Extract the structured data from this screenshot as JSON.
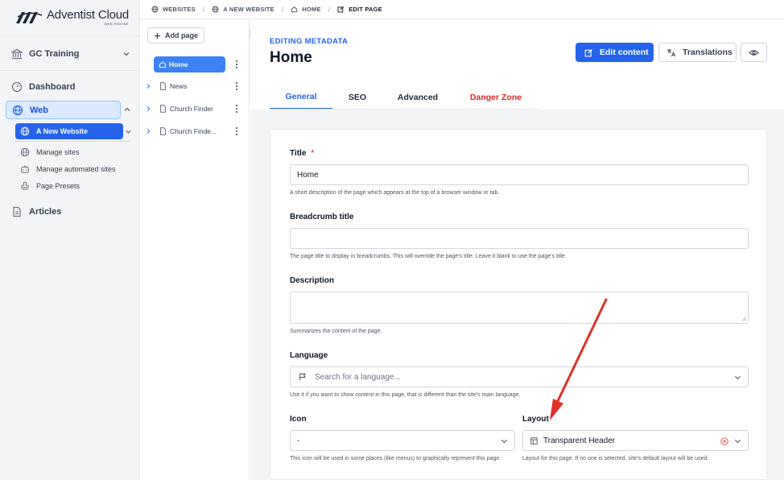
{
  "brand": {
    "name": "Adventist Cloud",
    "sub": "WEB ENGINE"
  },
  "sidebar": {
    "org": "GC Training",
    "dashboard": "Dashboard",
    "web": "Web",
    "site": "A New Website",
    "sub_items": [
      "Manage sites",
      "Manage automated sites",
      "Page Presets"
    ],
    "articles": "Articles"
  },
  "breadcrumb": {
    "websites": "WEBSITES",
    "new_website": "A NEW WEBSITE",
    "home": "HOME",
    "edit_page": "EDIT PAGE"
  },
  "tree": {
    "add_page": "Add page",
    "items": [
      "Home",
      "News",
      "Church Finder",
      "Church Finde..."
    ]
  },
  "header": {
    "kicker": "EDITING METADATA",
    "title": "Home",
    "edit_content": "Edit content",
    "translations": "Translations"
  },
  "tabs": [
    "General",
    "SEO",
    "Advanced",
    "Danger Zone"
  ],
  "form": {
    "title": {
      "label": "Title",
      "required": "*",
      "value": "Home",
      "help": "A short description of the page which appears at the top of a browser window or tab."
    },
    "breadcrumb_title": {
      "label": "Breadcrumb title",
      "value": "",
      "help": "The page title to display in breadcrumbs. This will override the page's title. Leave it blank to use the page's title."
    },
    "description": {
      "label": "Description",
      "value": "",
      "help": "Summarizes the content of the page."
    },
    "language": {
      "label": "Language",
      "placeholder": "Search for a language...",
      "help": "Use it if you want to show content in this page, that is different than the site's main language."
    },
    "icon": {
      "label": "Icon",
      "value": "-",
      "help": "This icon will be used in some places (like menus) to graphically represent this page."
    },
    "layout": {
      "label": "Layout",
      "value": "Transparent Header",
      "help": "Layout for this page. If no one is selected, site's default layout will be used."
    }
  },
  "colors": {
    "accent": "#2563eb",
    "danger": "#dc2626",
    "arrow": "#e0312b"
  }
}
